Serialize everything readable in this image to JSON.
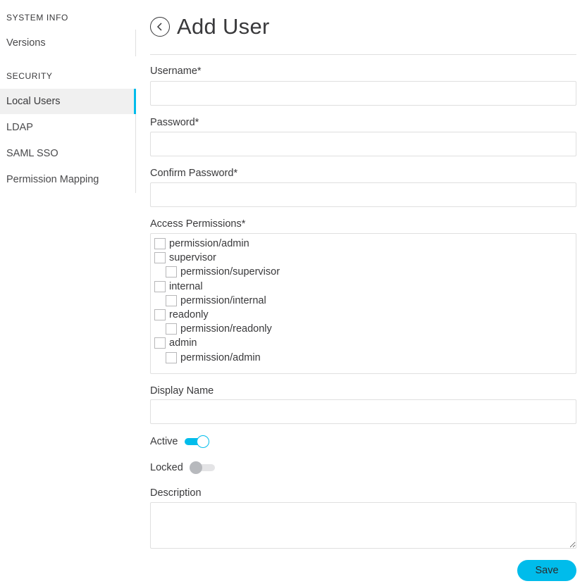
{
  "sidebar": {
    "sections": [
      {
        "heading": "SYSTEM INFO",
        "items": [
          {
            "label": "Versions",
            "active": false
          }
        ]
      },
      {
        "heading": "SECURITY",
        "items": [
          {
            "label": "Local Users",
            "active": true
          },
          {
            "label": "LDAP",
            "active": false
          },
          {
            "label": "SAML SSO",
            "active": false
          },
          {
            "label": "Permission Mapping",
            "active": false
          }
        ]
      }
    ]
  },
  "header": {
    "title": "Add User",
    "back_icon": "chevron-left-circle-icon"
  },
  "form": {
    "username": {
      "label": "Username*",
      "value": "",
      "placeholder": ""
    },
    "password": {
      "label": "Password*",
      "value": "",
      "placeholder": ""
    },
    "confirm_password": {
      "label": "Confirm Password*",
      "value": "",
      "placeholder": ""
    },
    "access_permissions": {
      "label": "Access Permissions*",
      "items": [
        {
          "label": "permission/admin",
          "level": 0,
          "checked": false
        },
        {
          "label": "supervisor",
          "level": 0,
          "checked": false
        },
        {
          "label": "permission/supervisor",
          "level": 1,
          "checked": false
        },
        {
          "label": "internal",
          "level": 0,
          "checked": false
        },
        {
          "label": "permission/internal",
          "level": 1,
          "checked": false
        },
        {
          "label": "readonly",
          "level": 0,
          "checked": false
        },
        {
          "label": "permission/readonly",
          "level": 1,
          "checked": false
        },
        {
          "label": "admin",
          "level": 0,
          "checked": false
        },
        {
          "label": "permission/admin",
          "level": 1,
          "checked": false
        }
      ]
    },
    "display_name": {
      "label": "Display Name",
      "value": "",
      "placeholder": ""
    },
    "active": {
      "label": "Active",
      "on": true
    },
    "locked": {
      "label": "Locked",
      "on": false
    },
    "description": {
      "label": "Description",
      "value": "",
      "placeholder": ""
    },
    "save_label": "Save"
  },
  "colors": {
    "accent": "#00bceb",
    "text": "#39393b",
    "border": "#dfdfdf"
  }
}
